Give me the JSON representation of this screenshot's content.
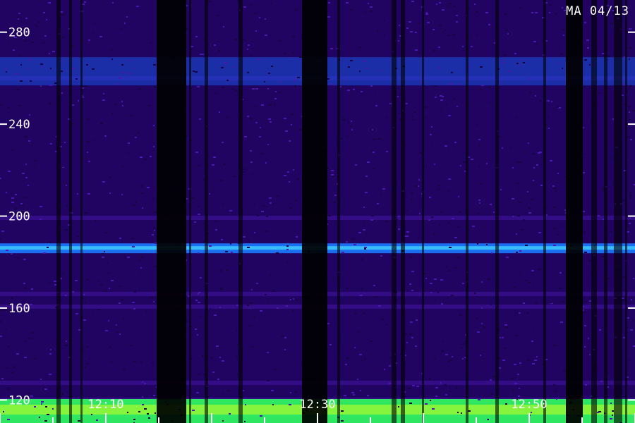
{
  "chart_data": {
    "type": "heatmap",
    "title": "",
    "label": "MA 04/13",
    "xlabel": "",
    "ylabel": "",
    "ylim": [
      110,
      294
    ],
    "y_ticks": [
      120,
      160,
      200,
      240,
      280
    ],
    "x_ticks": [
      "12:10",
      "12:30",
      "12:50"
    ],
    "x_range_minutes": [
      "12:02",
      "13:02"
    ],
    "colormap": [
      "#000000",
      "#1a0050",
      "#3a1090",
      "#2030d0",
      "#1070ff",
      "#20c0ff",
      "#30ff80",
      "#d0ff20"
    ],
    "bands": [
      {
        "freq": 186,
        "label": "strong horizontal line",
        "intensity": 0.85
      },
      {
        "freq": 263,
        "label": "broad band",
        "intensity": 0.6
      },
      {
        "freq": 112,
        "label": "bottom band",
        "intensity": 1.0
      }
    ]
  }
}
